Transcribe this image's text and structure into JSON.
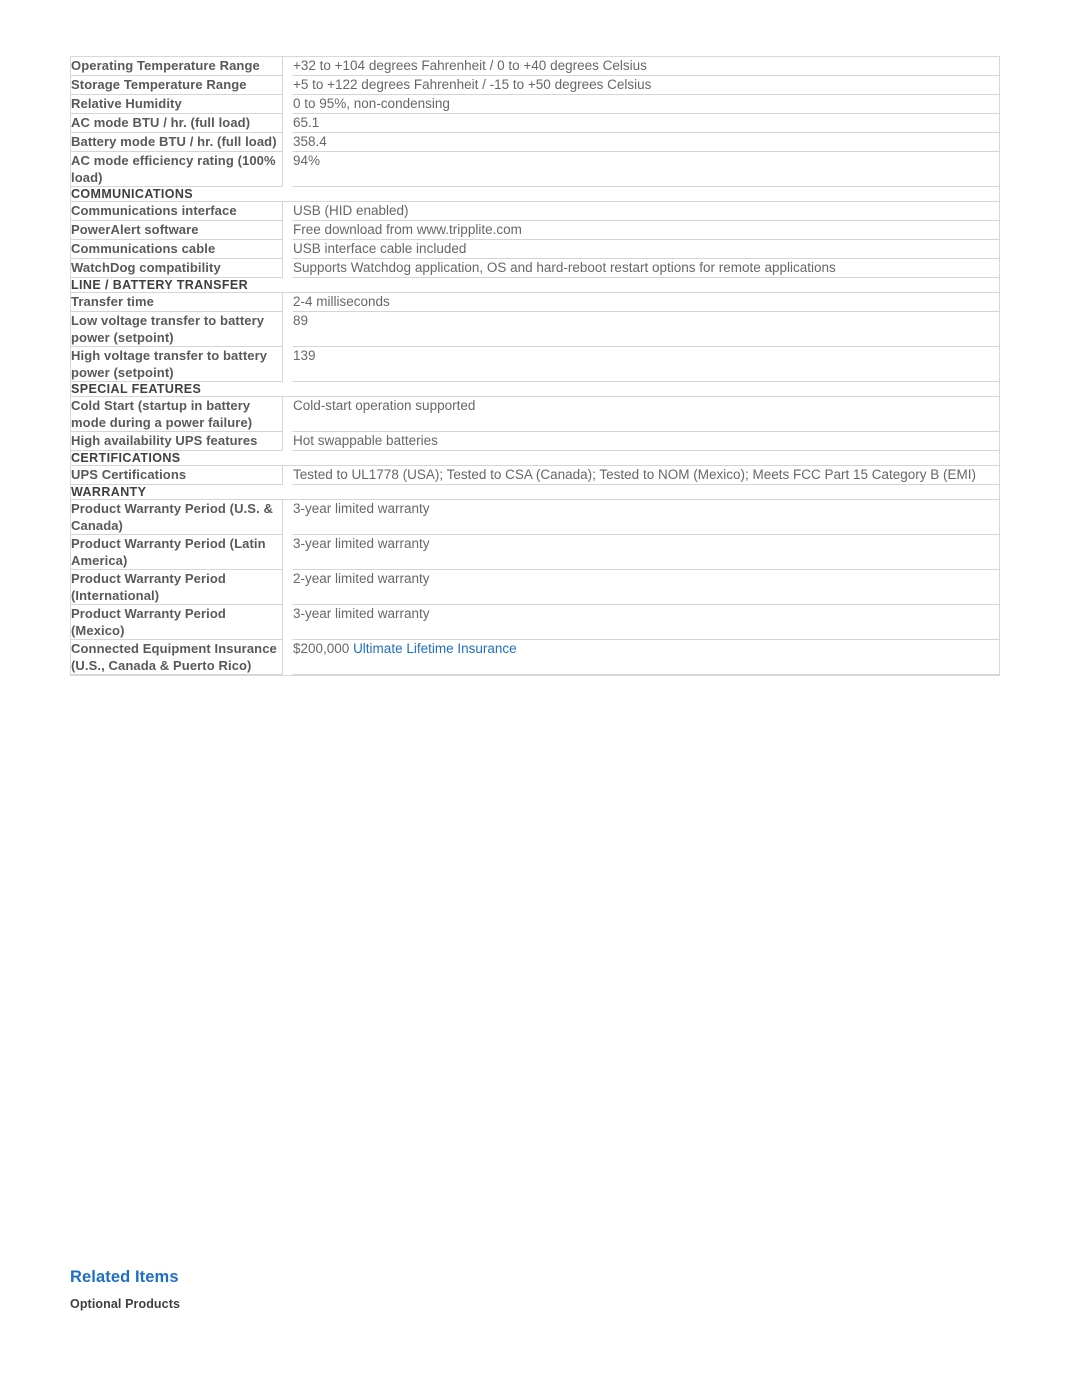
{
  "colors": {
    "link": "#1e6fc4",
    "label_text": "#595959",
    "value_text": "#676767",
    "section_text": "#3f3f3f",
    "border": "#d5d5d5"
  },
  "spec_table": {
    "rows": [
      {
        "kind": "spec",
        "label": "Operating Temperature Range",
        "value": "+32 to +104 degrees Fahrenheit / 0 to +40 degrees Celsius"
      },
      {
        "kind": "spec",
        "label": "Storage Temperature Range",
        "value": "+5 to +122 degrees Fahrenheit / -15 to +50 degrees Celsius"
      },
      {
        "kind": "spec",
        "label": "Relative Humidity",
        "value": "0 to 95%, non-condensing"
      },
      {
        "kind": "spec",
        "label": "AC mode BTU / hr. (full load)",
        "value": "65.1"
      },
      {
        "kind": "spec",
        "label": "Battery mode BTU / hr. (full load)",
        "value": "358.4"
      },
      {
        "kind": "spec",
        "label": "AC mode efficiency rating (100% load)",
        "value": "94%"
      },
      {
        "kind": "section",
        "label": "COMMUNICATIONS"
      },
      {
        "kind": "spec",
        "label": "Communications interface",
        "value": "USB (HID enabled)"
      },
      {
        "kind": "spec",
        "label": "PowerAlert software",
        "value": "Free download from www.tripplite.com"
      },
      {
        "kind": "spec",
        "label": "Communications cable",
        "value": "USB interface cable included"
      },
      {
        "kind": "spec",
        "label": "WatchDog compatibility",
        "value": "Supports Watchdog application, OS and hard-reboot restart options for remote applications"
      },
      {
        "kind": "section",
        "label": "LINE / BATTERY TRANSFER"
      },
      {
        "kind": "spec",
        "label": "Transfer time",
        "value": "2-4 milliseconds"
      },
      {
        "kind": "spec",
        "label": "Low voltage transfer to battery power (setpoint)",
        "value": "89"
      },
      {
        "kind": "spec",
        "label": "High voltage transfer to battery power (setpoint)",
        "value": "139"
      },
      {
        "kind": "section",
        "label": "SPECIAL FEATURES"
      },
      {
        "kind": "spec",
        "label": "Cold Start (startup in battery mode during a power failure)",
        "value": "Cold-start operation supported"
      },
      {
        "kind": "spec",
        "label": "High availability UPS features",
        "value": "Hot swappable batteries"
      },
      {
        "kind": "section",
        "label": "CERTIFICATIONS"
      },
      {
        "kind": "spec",
        "label": "UPS Certifications",
        "value": "Tested to UL1778 (USA); Tested to CSA (Canada); Tested to NOM (Mexico); Meets FCC Part 15 Category B (EMI)"
      },
      {
        "kind": "section",
        "label": "WARRANTY"
      },
      {
        "kind": "spec",
        "label": "Product Warranty Period (U.S. & Canada)",
        "value": "3-year limited warranty"
      },
      {
        "kind": "spec",
        "label": "Product Warranty Period (Latin America)",
        "value": "3-year limited warranty"
      },
      {
        "kind": "spec",
        "label": "Product Warranty Period (International)",
        "value": "2-year limited warranty"
      },
      {
        "kind": "spec",
        "label": "Product Warranty Period (Mexico)",
        "value": "3-year limited warranty"
      },
      {
        "kind": "spec",
        "label": "Connected Equipment Insurance (U.S., Canada & Puerto Rico)",
        "value": "$200,000 ",
        "link_text": "Ultimate Lifetime Insurance"
      }
    ]
  },
  "related_items": {
    "title": "Related Items",
    "subtitle": "Optional Products"
  }
}
